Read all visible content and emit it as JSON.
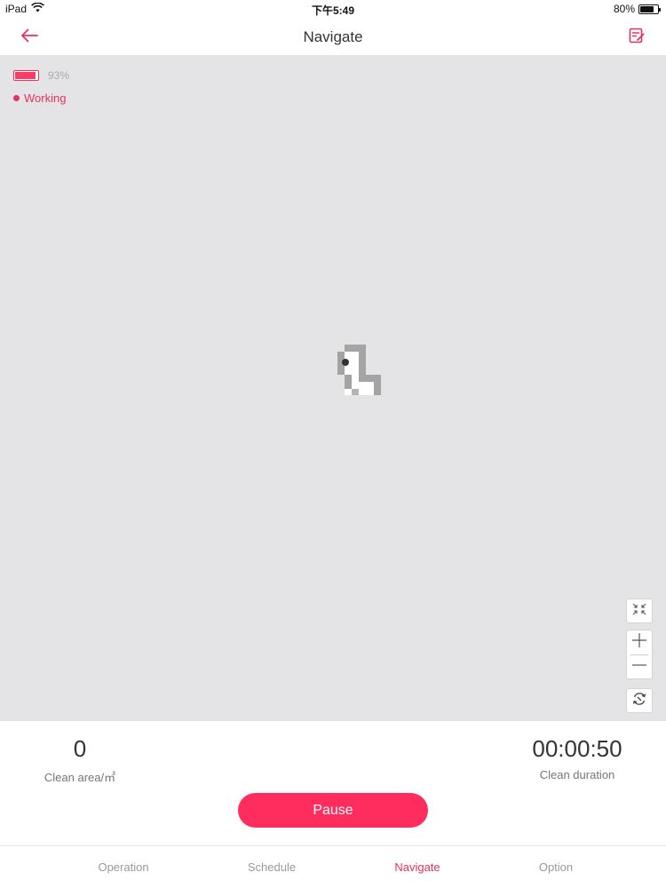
{
  "status_bar": {
    "device": "iPad",
    "time": "下午5:49",
    "battery_percent": "80%",
    "battery_level": 0.8
  },
  "header": {
    "title": "Navigate",
    "back_icon": "arrow-left-icon",
    "edit_icon": "edit-note-icon"
  },
  "map": {
    "battery_label": "93%",
    "battery_level": 0.93,
    "status": "Working",
    "controls": {
      "fit_icon": "collapse-arrows-icon",
      "zoom_in_icon": "plus-icon",
      "zoom_out_icon": "minus-icon",
      "rotate_icon": "rotate-icon"
    }
  },
  "stats": {
    "clean_area_value": "0",
    "clean_area_label": "Clean area/㎡",
    "clean_duration_value": "00:00:50",
    "clean_duration_label": "Clean duration"
  },
  "actions": {
    "pause_label": "Pause"
  },
  "tabs": [
    {
      "label": "Operation",
      "active": false
    },
    {
      "label": "Schedule",
      "active": false
    },
    {
      "label": "Navigate",
      "active": true
    },
    {
      "label": "Option",
      "active": false
    }
  ],
  "colors": {
    "accent": "#e8315c",
    "button": "#ff2d5d",
    "map_background": "#e4e4e6"
  }
}
